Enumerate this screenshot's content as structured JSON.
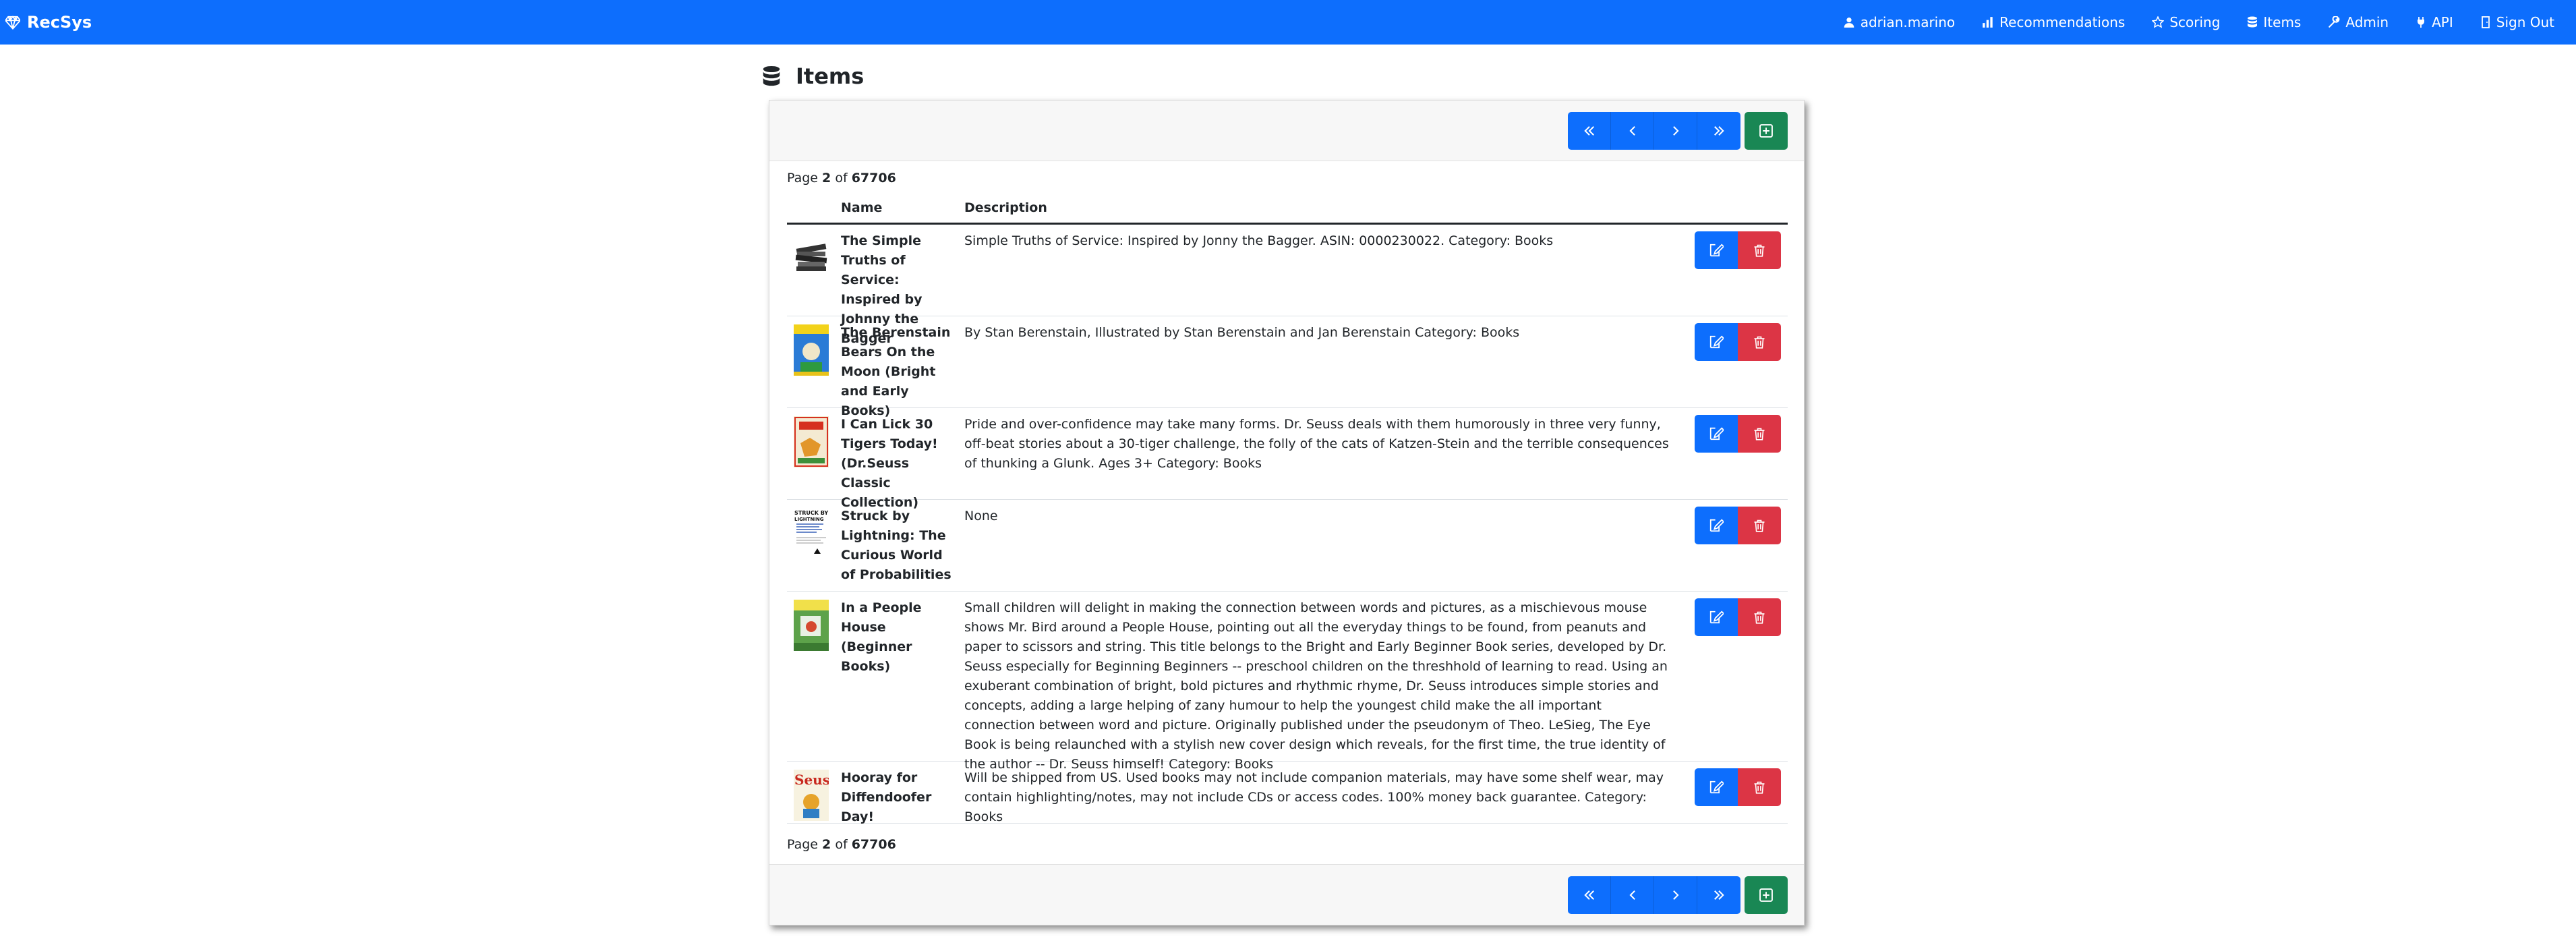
{
  "navbar": {
    "brand": "RecSys",
    "links": [
      {
        "label": "adrian.marino",
        "icon": "user-icon"
      },
      {
        "label": "Recommendations",
        "icon": "bar-chart-icon"
      },
      {
        "label": "Scoring",
        "icon": "star-icon"
      },
      {
        "label": "Items",
        "icon": "database-icon"
      },
      {
        "label": "Admin",
        "icon": "wrench-icon"
      },
      {
        "label": "API",
        "icon": "plug-icon"
      },
      {
        "label": "Sign Out",
        "icon": "door-icon"
      }
    ]
  },
  "page": {
    "title": "Items"
  },
  "pagination": {
    "prefix": "Page",
    "current": "2",
    "of": "of",
    "total": "67706"
  },
  "table": {
    "headers": {
      "image": "",
      "name": "Name",
      "description": "Description"
    },
    "rows": [
      {
        "name": "The Simple Truths of Service: Inspired by Johnny the Bagger",
        "description": "Simple Truths of Service: Inspired by Jonny the Bagger. ASIN: 0000230022. Category: Books",
        "thumb": "stack-of-books"
      },
      {
        "name": "The Berenstain Bears On the Moon (Bright and Early Books)",
        "description": "By Stan Berenstain, Illustrated by Stan Berenstain and Jan Berenstain Category: Books",
        "thumb": "berenstain-cover"
      },
      {
        "name": "I Can Lick 30 Tigers Today! (Dr.Seuss Classic Collection)",
        "description": "Pride and over-confidence may take many forms. Dr. Seuss deals with them humorously in three very funny, off-beat stories about a 30-tiger challenge, the folly of the cats of Katzen-Stein and the terrible consequences of thunking a Glunk. Ages 3+ Category: Books",
        "thumb": "tigers-cover"
      },
      {
        "name": "Struck by Lightning: The Curious World of Probabilities",
        "description": "None",
        "thumb": "struck-cover",
        "thumb_text": "STRUCK BY LIGHTNING"
      },
      {
        "name": "In a People House (Beginner Books)",
        "description": "Small children will delight in making the connection between words and pictures, as a mischievous mouse shows Mr. Bird around a People House, pointing out all the everyday things to be found, from peanuts and paper to scissors and string. This title belongs to the Bright and Early Beginner Book series, developed by Dr. Seuss especially for Beginning Beginners -- preschool children on the threshhold of learning to read. Using an exuberant combination of bright, bold pictures and rhythmic rhyme, Dr. Seuss introduces simple stories and concepts, adding a large helping of zany humour to help the youngest child make the all important connection between word and picture. Originally published under the pseudonym of Theo. LeSieg, The Eye Book is being relaunched with a stylish new cover design which reveals, for the first time, the true identity of the author -- Dr. Seuss himself! Category: Books",
        "thumb": "people-house-cover"
      },
      {
        "name": "Hooray for Diffendoofer Day!",
        "description": "Will be shipped from US. Used books may not include companion materials, may have some shelf wear, may contain highlighting/notes, may not include CDs or access codes. 100% money back guarantee. Category: Books",
        "thumb": "seuss-cover",
        "thumb_text": "Seuss"
      }
    ]
  },
  "colors": {
    "primary": "#0d6efd",
    "success": "#198754",
    "danger": "#dc3545"
  }
}
